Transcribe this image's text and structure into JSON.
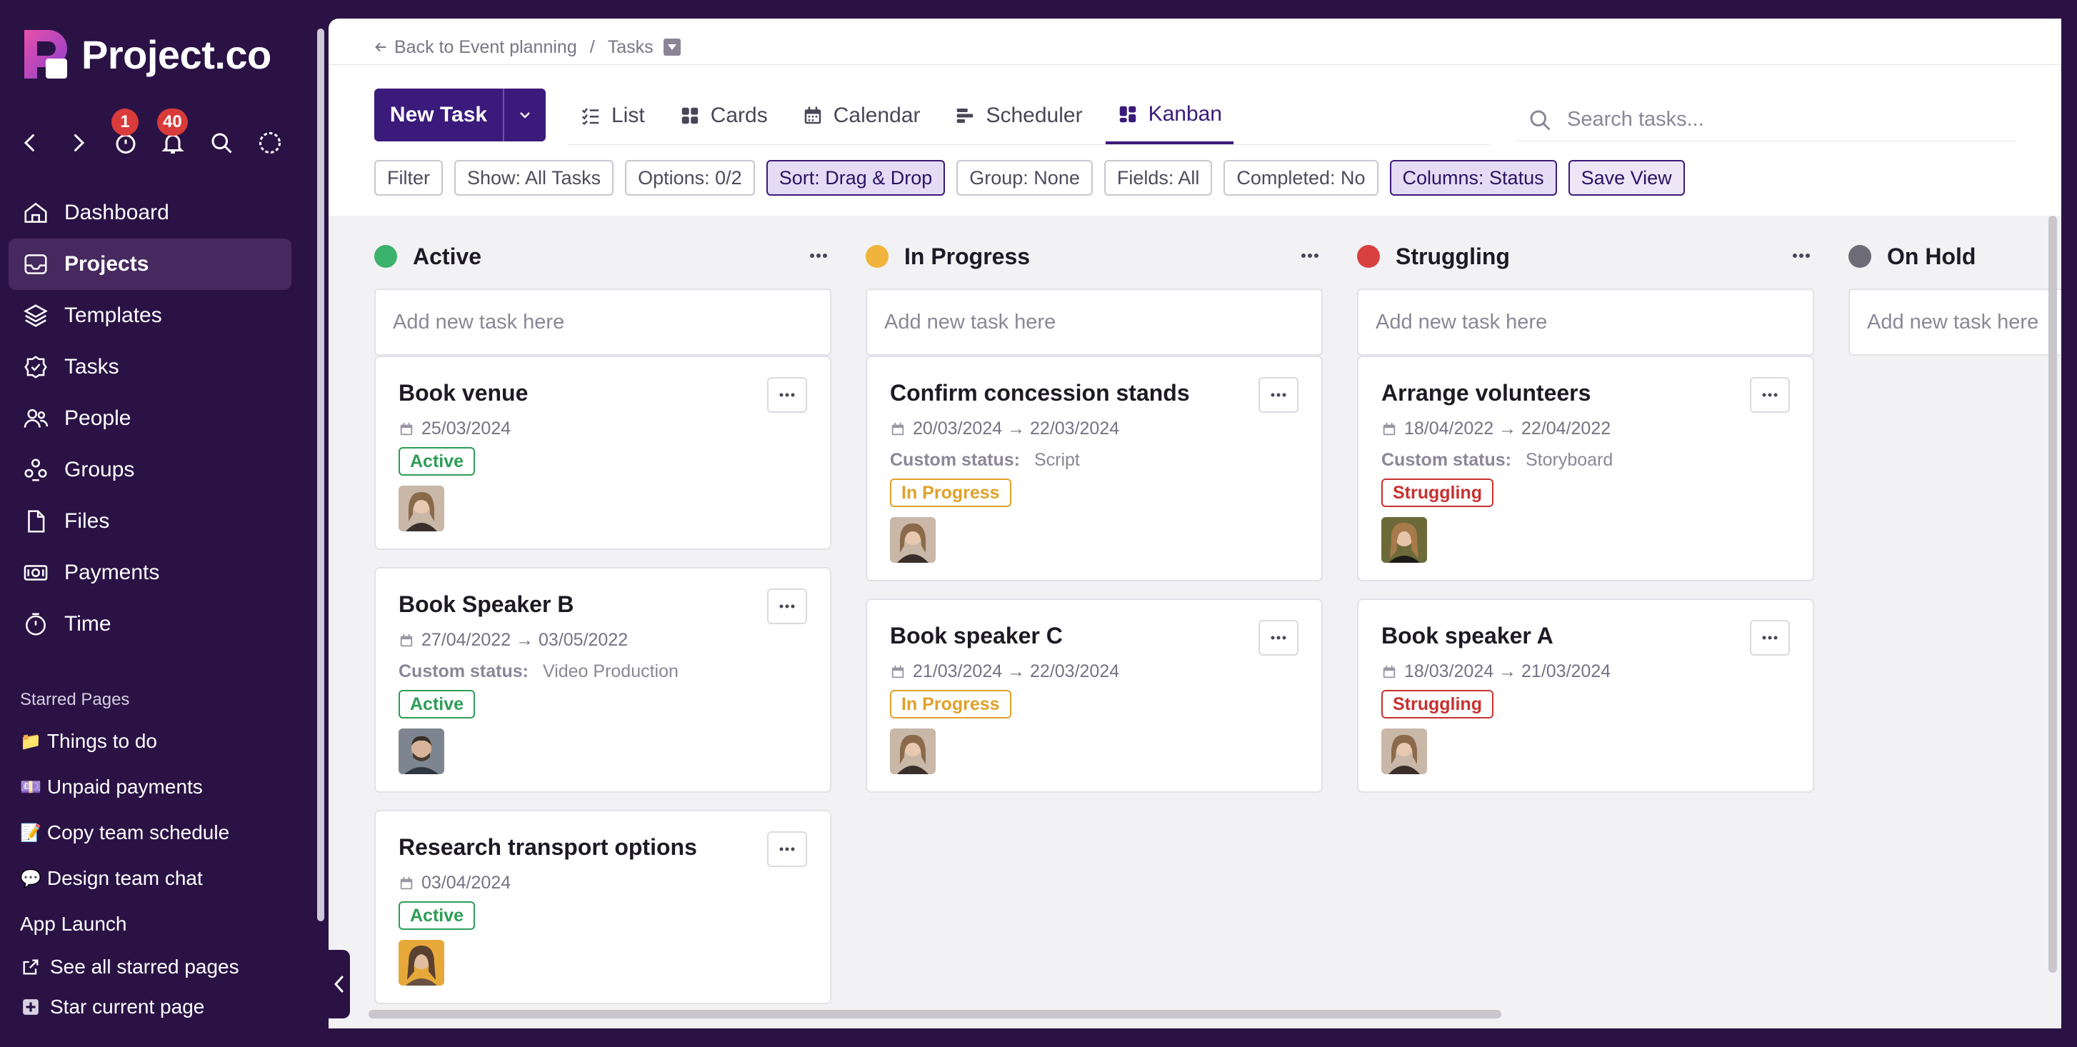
{
  "brand": {
    "name": "Project.co"
  },
  "toolbar": {
    "timer_badge": "1",
    "notifications_badge": "40"
  },
  "sidebar": {
    "items": [
      {
        "label": "Dashboard"
      },
      {
        "label": "Projects"
      },
      {
        "label": "Templates"
      },
      {
        "label": "Tasks"
      },
      {
        "label": "People"
      },
      {
        "label": "Groups"
      },
      {
        "label": "Files"
      },
      {
        "label": "Payments"
      },
      {
        "label": "Time"
      }
    ],
    "starred_title": "Starred Pages",
    "starred": [
      {
        "emoji": "📁",
        "label": "Things to do"
      },
      {
        "emoji": "💷",
        "label": "Unpaid payments"
      },
      {
        "emoji": "📝",
        "label": "Copy team schedule"
      },
      {
        "emoji": "💬",
        "label": "Design team chat"
      },
      {
        "emoji": "",
        "label": "App Launch"
      }
    ],
    "see_all": "See all starred pages",
    "star_current": "Star current page"
  },
  "breadcrumb": {
    "back": "Back to Event planning",
    "separator": "/",
    "current": "Tasks"
  },
  "actions": {
    "new_task": "New Task"
  },
  "views": [
    {
      "label": "List"
    },
    {
      "label": "Cards"
    },
    {
      "label": "Calendar"
    },
    {
      "label": "Scheduler"
    },
    {
      "label": "Kanban"
    }
  ],
  "search": {
    "placeholder": "Search tasks..."
  },
  "filters": [
    {
      "label": "Filter"
    },
    {
      "label": "Show: All Tasks"
    },
    {
      "label": "Options: 0/2"
    },
    {
      "label": "Sort: Drag & Drop"
    },
    {
      "label": "Group: None"
    },
    {
      "label": "Fields: All"
    },
    {
      "label": "Completed: No"
    },
    {
      "label": "Columns: Status"
    },
    {
      "label": "Save View"
    }
  ],
  "add_placeholder": "Add new task here",
  "custom_status_label": "Custom status:",
  "colors": {
    "active": "#3bb26b",
    "in_progress": "#f0b43c",
    "struggling": "#d94040",
    "on_hold": "#6f6c7a",
    "brand": "#3a1a7a"
  },
  "columns": [
    {
      "title": "Active",
      "cards": [
        {
          "title": "Book venue",
          "date": "25/03/2024",
          "status": "Active"
        },
        {
          "title": "Book Speaker B",
          "date": "27/04/2022 → 03/05/2022",
          "custom": "Video Production",
          "status": "Active"
        },
        {
          "title": "Research transport options",
          "date": "03/04/2024",
          "status": "Active"
        }
      ]
    },
    {
      "title": "In Progress",
      "cards": [
        {
          "title": "Confirm concession stands",
          "date": "20/03/2024 → 22/03/2024",
          "custom": "Script",
          "status": "In Progress"
        },
        {
          "title": "Book speaker C",
          "date": "21/03/2024 → 22/03/2024",
          "status": "In Progress"
        }
      ]
    },
    {
      "title": "Struggling",
      "cards": [
        {
          "title": "Arrange volunteers",
          "date": "18/04/2022 → 22/04/2022",
          "custom": "Storyboard",
          "status": "Struggling"
        },
        {
          "title": "Book speaker A",
          "date": "18/03/2024 → 21/03/2024",
          "status": "Struggling"
        }
      ]
    },
    {
      "title": "On Hold",
      "cards": []
    }
  ]
}
